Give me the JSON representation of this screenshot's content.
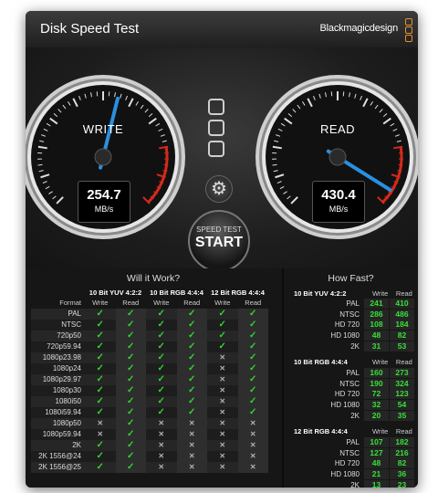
{
  "window": {
    "title": "Disk Speed Test",
    "brand": "Blackmagicdesign"
  },
  "gauges": {
    "write": {
      "label": "WRITE",
      "value": "254.7",
      "unit": "MB/s"
    },
    "read": {
      "label": "READ",
      "value": "430.4",
      "unit": "MB/s"
    }
  },
  "start_button": {
    "top": "SPEED TEST",
    "main": "START"
  },
  "left_panel": {
    "title": "Will it Work?",
    "format_header": "Format",
    "groups": [
      "10 Bit YUV 4:2:2",
      "10 Bit RGB 4:4:4",
      "12 Bit RGB 4:4:4"
    ],
    "sub_headers": [
      "Write",
      "Read"
    ],
    "rows": [
      {
        "format": "PAL",
        "marks": [
          "y",
          "y",
          "y",
          "y",
          "y",
          "y"
        ]
      },
      {
        "format": "NTSC",
        "marks": [
          "y",
          "y",
          "y",
          "y",
          "y",
          "y"
        ]
      },
      {
        "format": "720p50",
        "marks": [
          "y",
          "y",
          "y",
          "y",
          "y",
          "y"
        ]
      },
      {
        "format": "720p59.94",
        "marks": [
          "y",
          "y",
          "y",
          "y",
          "y",
          "y"
        ]
      },
      {
        "format": "1080p23.98",
        "marks": [
          "y",
          "y",
          "y",
          "y",
          "x",
          "y"
        ]
      },
      {
        "format": "1080p24",
        "marks": [
          "y",
          "y",
          "y",
          "y",
          "x",
          "y"
        ]
      },
      {
        "format": "1080p29.97",
        "marks": [
          "y",
          "y",
          "y",
          "y",
          "x",
          "y"
        ]
      },
      {
        "format": "1080p30",
        "marks": [
          "y",
          "y",
          "y",
          "y",
          "x",
          "y"
        ]
      },
      {
        "format": "1080i50",
        "marks": [
          "y",
          "y",
          "y",
          "y",
          "x",
          "y"
        ]
      },
      {
        "format": "1080i59.94",
        "marks": [
          "y",
          "y",
          "y",
          "y",
          "x",
          "y"
        ]
      },
      {
        "format": "1080p50",
        "marks": [
          "x",
          "y",
          "x",
          "x",
          "x",
          "x"
        ]
      },
      {
        "format": "1080p59.94",
        "marks": [
          "x",
          "y",
          "x",
          "x",
          "x",
          "x"
        ]
      },
      {
        "format": "2K 1556@23.98",
        "marks": [
          "y",
          "y",
          "x",
          "x",
          "x",
          "x"
        ]
      },
      {
        "format": "2K 1556@24",
        "marks": [
          "y",
          "y",
          "x",
          "x",
          "x",
          "x"
        ]
      },
      {
        "format": "2K 1556@25",
        "marks": [
          "y",
          "y",
          "x",
          "x",
          "x",
          "x"
        ]
      }
    ]
  },
  "right_panel": {
    "title": "How Fast?",
    "sub_headers": [
      "Write",
      "Read"
    ],
    "groups": [
      {
        "name": "10 Bit YUV 4:2:2",
        "rows": [
          {
            "format": "PAL",
            "write": "241",
            "read": "410"
          },
          {
            "format": "NTSC",
            "write": "286",
            "read": "486"
          },
          {
            "format": "HD 720",
            "write": "108",
            "read": "184"
          },
          {
            "format": "HD 1080",
            "write": "48",
            "read": "82"
          },
          {
            "format": "2K",
            "write": "31",
            "read": "53"
          }
        ]
      },
      {
        "name": "10 Bit RGB 4:4:4",
        "rows": [
          {
            "format": "PAL",
            "write": "160",
            "read": "273"
          },
          {
            "format": "NTSC",
            "write": "190",
            "read": "324"
          },
          {
            "format": "HD 720",
            "write": "72",
            "read": "123"
          },
          {
            "format": "HD 1080",
            "write": "32",
            "read": "54"
          },
          {
            "format": "2K",
            "write": "20",
            "read": "35"
          }
        ]
      },
      {
        "name": "12 Bit RGB 4:4:4",
        "rows": [
          {
            "format": "PAL",
            "write": "107",
            "read": "182"
          },
          {
            "format": "NTSC",
            "write": "127",
            "read": "216"
          },
          {
            "format": "HD 720",
            "write": "48",
            "read": "82"
          },
          {
            "format": "HD 1080",
            "write": "21",
            "read": "36"
          },
          {
            "format": "2K",
            "write": "13",
            "read": "23"
          }
        ]
      }
    ]
  },
  "colors": {
    "check": "#35d135",
    "speed_value": "#38e038",
    "needle": "#2a8fe0",
    "redline": "#d42a1a",
    "brand_accent": "#e8902c"
  },
  "icons": {
    "selector": "stacked-squares-icon",
    "settings": "gear-icon",
    "check": "check-icon",
    "cross": "x-icon"
  }
}
